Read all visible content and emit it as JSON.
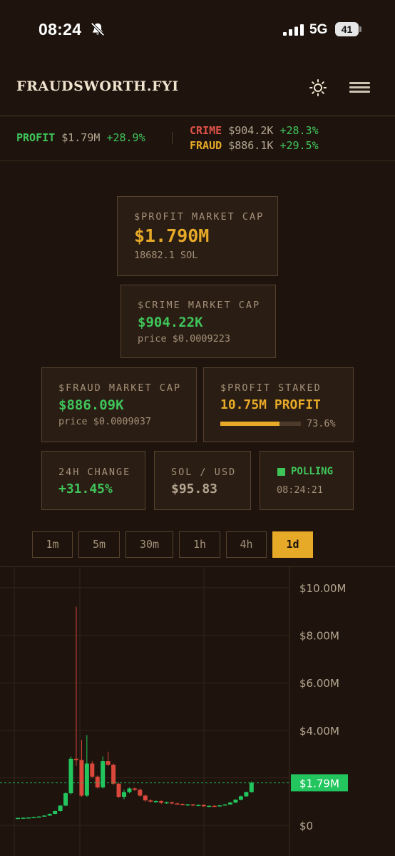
{
  "status_bar": {
    "time": "08:24",
    "network": "5G",
    "battery": "41"
  },
  "header": {
    "brand": "FRAUDSWORTH.FYI"
  },
  "ticker": {
    "profit": {
      "symbol": "PROFIT",
      "value": "$1.79M",
      "change": "+28.9%"
    },
    "crime": {
      "symbol": "CRIME",
      "value": "$904.2K",
      "change": "+28.3%"
    },
    "fraud": {
      "symbol": "FRAUD",
      "value": "$886.1K",
      "change": "+29.5%"
    }
  },
  "cards": {
    "profit_mcap": {
      "label": "$PROFIT MARKET CAP",
      "value": "$1.790M",
      "sub": "18682.1 SOL"
    },
    "crime_mcap": {
      "label": "$CRIME MARKET CAP",
      "value": "$904.22K",
      "sub": "price $0.0009223"
    },
    "fraud_mcap": {
      "label": "$FRAUD MARKET CAP",
      "value": "$886.09K",
      "sub": "price $0.0009037"
    },
    "staked": {
      "label": "$PROFIT STAKED",
      "value": "10.75M PROFIT",
      "percent_text": "73.6%",
      "percent": 73.6
    },
    "change_24h": {
      "label": "24H CHANGE",
      "value": "+31.45%"
    },
    "sol_usd": {
      "label": "SOL / USD",
      "value": "$95.83"
    },
    "polling": {
      "label": "POLLING",
      "time": "08:24:21"
    }
  },
  "timeframes": {
    "items": [
      "1m",
      "5m",
      "30m",
      "1h",
      "4h",
      "1d"
    ],
    "active": "1d"
  },
  "chart": {
    "price_label": "$1.79M"
  },
  "chart_data": {
    "type": "candlestick",
    "y_ticks": [
      "$10.00M",
      "$8.00M",
      "$6.00M",
      "$4.00M",
      "$0"
    ],
    "ylim": [
      0,
      10000000
    ],
    "current_price": 1790000,
    "colors": {
      "up": "#22c55e",
      "down": "#d9483b",
      "grid": "#33251a",
      "axis_text": "#b5a691"
    },
    "candles": [
      {
        "o": 0.3,
        "h": 0.32,
        "l": 0.28,
        "c": 0.31
      },
      {
        "o": 0.31,
        "h": 0.33,
        "l": 0.29,
        "c": 0.32
      },
      {
        "o": 0.32,
        "h": 0.34,
        "l": 0.3,
        "c": 0.33
      },
      {
        "o": 0.33,
        "h": 0.36,
        "l": 0.32,
        "c": 0.35
      },
      {
        "o": 0.35,
        "h": 0.38,
        "l": 0.34,
        "c": 0.37
      },
      {
        "o": 0.37,
        "h": 0.42,
        "l": 0.36,
        "c": 0.41
      },
      {
        "o": 0.41,
        "h": 0.5,
        "l": 0.4,
        "c": 0.48
      },
      {
        "o": 0.48,
        "h": 0.62,
        "l": 0.47,
        "c": 0.6
      },
      {
        "o": 0.6,
        "h": 0.85,
        "l": 0.58,
        "c": 0.83
      },
      {
        "o": 0.83,
        "h": 1.4,
        "l": 0.8,
        "c": 1.35
      },
      {
        "o": 1.35,
        "h": 2.9,
        "l": 1.3,
        "c": 2.8
      },
      {
        "o": 2.8,
        "h": 9.2,
        "l": 2.5,
        "c": 2.75
      },
      {
        "o": 2.75,
        "h": 3.6,
        "l": 1.2,
        "c": 1.25
      },
      {
        "o": 1.25,
        "h": 3.8,
        "l": 1.2,
        "c": 2.6
      },
      {
        "o": 2.6,
        "h": 2.7,
        "l": 2.0,
        "c": 2.05
      },
      {
        "o": 2.05,
        "h": 2.1,
        "l": 1.55,
        "c": 1.6
      },
      {
        "o": 1.6,
        "h": 2.9,
        "l": 1.55,
        "c": 2.7
      },
      {
        "o": 2.7,
        "h": 3.1,
        "l": 2.5,
        "c": 2.55
      },
      {
        "o": 2.55,
        "h": 2.6,
        "l": 1.7,
        "c": 1.75
      },
      {
        "o": 1.75,
        "h": 1.8,
        "l": 1.15,
        "c": 1.2
      },
      {
        "o": 1.2,
        "h": 1.5,
        "l": 1.1,
        "c": 1.4
      },
      {
        "o": 1.4,
        "h": 1.6,
        "l": 1.35,
        "c": 1.55
      },
      {
        "o": 1.55,
        "h": 1.6,
        "l": 1.45,
        "c": 1.5
      },
      {
        "o": 1.5,
        "h": 1.55,
        "l": 1.2,
        "c": 1.25
      },
      {
        "o": 1.25,
        "h": 1.3,
        "l": 1.0,
        "c": 1.05
      },
      {
        "o": 1.05,
        "h": 1.1,
        "l": 0.95,
        "c": 1.0
      },
      {
        "o": 1.0,
        "h": 1.05,
        "l": 0.95,
        "c": 1.02
      },
      {
        "o": 1.02,
        "h": 1.05,
        "l": 0.9,
        "c": 0.95
      },
      {
        "o": 0.95,
        "h": 1.0,
        "l": 0.9,
        "c": 0.97
      },
      {
        "o": 0.97,
        "h": 1.0,
        "l": 0.88,
        "c": 0.92
      },
      {
        "o": 0.92,
        "h": 0.96,
        "l": 0.87,
        "c": 0.9
      },
      {
        "o": 0.9,
        "h": 0.93,
        "l": 0.84,
        "c": 0.86
      },
      {
        "o": 0.86,
        "h": 0.9,
        "l": 0.82,
        "c": 0.88
      },
      {
        "o": 0.88,
        "h": 0.9,
        "l": 0.8,
        "c": 0.84
      },
      {
        "o": 0.84,
        "h": 0.88,
        "l": 0.8,
        "c": 0.86
      },
      {
        "o": 0.86,
        "h": 0.88,
        "l": 0.78,
        "c": 0.8
      },
      {
        "o": 0.8,
        "h": 0.84,
        "l": 0.77,
        "c": 0.82
      },
      {
        "o": 0.82,
        "h": 0.85,
        "l": 0.78,
        "c": 0.8
      },
      {
        "o": 0.8,
        "h": 0.85,
        "l": 0.78,
        "c": 0.84
      },
      {
        "o": 0.84,
        "h": 0.9,
        "l": 0.82,
        "c": 0.88
      },
      {
        "o": 0.88,
        "h": 0.98,
        "l": 0.86,
        "c": 0.96
      },
      {
        "o": 0.96,
        "h": 1.1,
        "l": 0.94,
        "c": 1.08
      },
      {
        "o": 1.08,
        "h": 1.25,
        "l": 1.05,
        "c": 1.22
      },
      {
        "o": 1.22,
        "h": 1.42,
        "l": 1.2,
        "c": 1.4
      },
      {
        "o": 1.4,
        "h": 1.85,
        "l": 1.38,
        "c": 1.79
      }
    ]
  }
}
